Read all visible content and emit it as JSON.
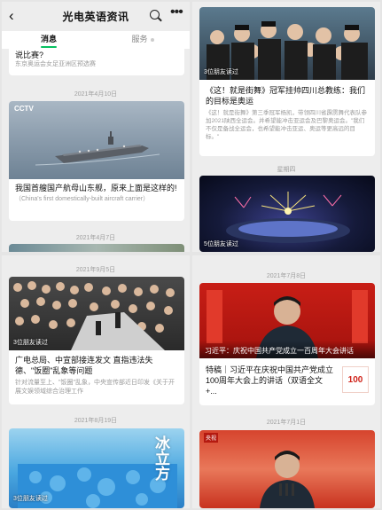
{
  "p1": {
    "header": {
      "title": "光电英语资讯"
    },
    "tabs": [
      "消息",
      "服务"
    ],
    "top_card": {
      "title": "说比赛?",
      "summary": "东京奥运会女足亚洲区预选赛"
    },
    "date1": "2021年4月10日",
    "card2": {
      "logo": "CCTV",
      "title": "我国首艘国产航母山东舰，原来上面是这样的!",
      "summary": "（China's first domestically-built aircraft carrier）"
    },
    "date2": "2021年4月7日"
  },
  "p2": {
    "card1": {
      "friends": "3位朋友读过",
      "title": "《这！就是街舞》冠军挂帅四川总教练：我们的目标是奥运",
      "summary": "《这！就是街舞》第三季冠军杨凯，带领四川省霹雳舞代表队参加2021陕西全运会。并希望能冲击亚运会及巴黎奥运会。\"我们不仅是备战全运会，也希望能冲击亚运、奥运等更高远的目标。\""
    },
    "date1": "星期四",
    "card2": {
      "friends": "5位朋友读过"
    }
  },
  "p3": {
    "date1": "2021年9月5日",
    "card1": {
      "friends": "3位朋友读过",
      "title": "广电总局、中宣部接连发文 直指违法失德、\"饭圈\"乱象等问题",
      "summary": "针对流量至上、\"饭圈\"乱象，中央宣传部近日印发《关于开展文娱领域综合治理工作"
    },
    "date2": "2021年8月19日",
    "card2": {
      "overlay": "冰立方",
      "friends": "3位朋友读过"
    }
  },
  "p4": {
    "date1": "2021年7月8日",
    "card1": {
      "caption": "习近平：庆祝中国共产党成立一百周年大会讲话",
      "title": "特稿｜习近平在庆祝中国共产党成立100周年大会上的讲话（双语全文+...",
      "thumb": "100"
    },
    "date2": "2021年7月1日",
    "card2": {
      "tag": "央视"
    }
  },
  "colors": {
    "accent": "#07c160",
    "bg": "#ededed",
    "card": "#ffffff",
    "meta": "#9a9a9a"
  }
}
